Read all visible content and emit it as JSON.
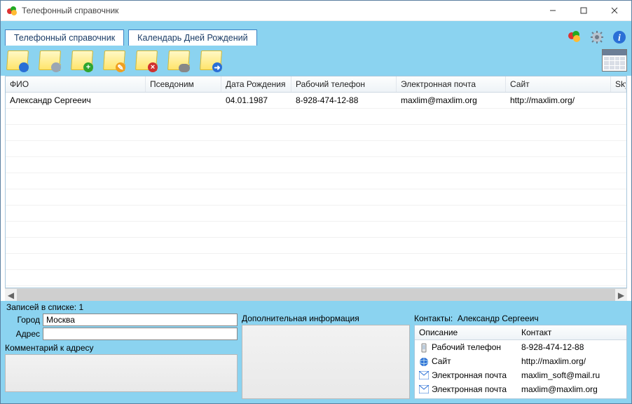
{
  "window": {
    "title": "Телефонный справочник"
  },
  "tabs": [
    {
      "label": "Телефонный справочник",
      "active": true
    },
    {
      "label": "Календарь Дней Рождений",
      "active": false
    }
  ],
  "corner": {
    "balloons": "decor",
    "settings": "settings",
    "about": "about"
  },
  "toolbar": {
    "items": [
      {
        "name": "note-filter",
        "badge": "mag"
      },
      {
        "name": "note-funnel",
        "badge": "funnel"
      },
      {
        "name": "note-add",
        "badge": "plus",
        "glyph": "+"
      },
      {
        "name": "note-edit",
        "badge": "edit",
        "glyph": "✎"
      },
      {
        "name": "note-delete",
        "badge": "del",
        "glyph": "×"
      },
      {
        "name": "note-search",
        "badge": "search",
        "glyph": " "
      },
      {
        "name": "note-export",
        "badge": "blue",
        "glyph": "➜"
      }
    ]
  },
  "grid": {
    "columns": [
      "ФИО",
      "Псевдоним",
      "Дата Рождения",
      "Рабочий телефон",
      "Электронная почта",
      "Сайт",
      "Skype"
    ],
    "rows": [
      {
        "c0": "Александр Сергееич",
        "c1": "",
        "c2": "04.01.1987",
        "c3": "8-928-474-12-88",
        "c4": "maxlim@maxlim.org",
        "c5": "http://maxlim.org/",
        "c6": ""
      }
    ],
    "emptyRows": 11
  },
  "status": {
    "text": "Записей в списке: 1"
  },
  "address": {
    "cityLabel": "Город",
    "cityValue": "Москва",
    "addrLabel": "Адрес",
    "addrValue": "",
    "commentLabel": "Комментарий к адресу"
  },
  "extra": {
    "label": "Дополнительная информация"
  },
  "contacts": {
    "headerPrefix": "Контакты:",
    "headerName": "Александр Сергееич",
    "columns": [
      "Описание",
      "Контакт"
    ],
    "rows": [
      {
        "icon": "phone",
        "desc": "Рабочий телефон",
        "val": "8-928-474-12-88"
      },
      {
        "icon": "globe",
        "desc": "Сайт",
        "val": "http://maxlim.org/"
      },
      {
        "icon": "mail",
        "desc": "Электронная почта",
        "val": "maxlim_soft@mail.ru"
      },
      {
        "icon": "mail",
        "desc": "Электронная почта",
        "val": "maxlim@maxlim.org"
      }
    ]
  }
}
